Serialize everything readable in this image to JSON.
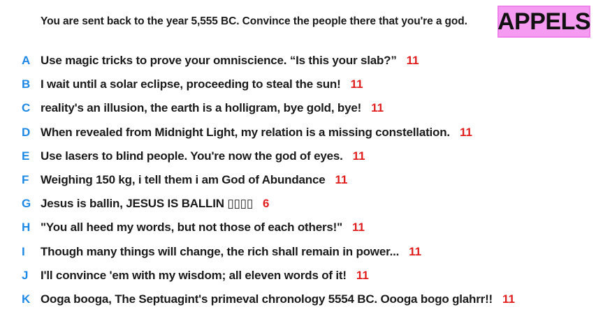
{
  "prompt": "You are sent back to the year 5,555 BC. Convince the people there that you're a god.",
  "logo": "APPELS",
  "colors": {
    "letter": "#1e88e5",
    "score": "#e01e1e",
    "logo_bg": "#f59cf2"
  },
  "answers": [
    {
      "letter": "A",
      "text": "Use magic tricks to prove your omniscience. “Is this your slab?”",
      "score": "11"
    },
    {
      "letter": "B",
      "text": "I wait until a solar eclipse, proceeding to steal the sun!",
      "score": "11"
    },
    {
      "letter": "C",
      "text": "reality's an illusion, the earth is a holligram, bye gold, bye!",
      "score": "11"
    },
    {
      "letter": "D",
      "text": "When revealed from Midnight Light, my relation is a missing constellation.",
      "score": "11"
    },
    {
      "letter": "E",
      "text": "Use lasers to blind people. You're now the god of eyes.",
      "score": "11"
    },
    {
      "letter": "F",
      "text": "Weighing 150 kg, i tell them i am God of Abundance",
      "score": "11"
    },
    {
      "letter": "G",
      "text": "Jesus is ballin, JESUS IS BALLIN ▯▯▯▯",
      "score": "6"
    },
    {
      "letter": "H",
      "text": "\"You all heed my words, but not those of each others!\"",
      "score": "11"
    },
    {
      "letter": "I",
      "text": "Though many things will change, the rich shall remain in power...",
      "score": "11"
    },
    {
      "letter": "J",
      "text": "I'll convince 'em with my wisdom; all eleven words of it!",
      "score": "11"
    },
    {
      "letter": "K",
      "text": "Ooga booga, The Septuagint's primeval chronology 5554 BC. Oooga bogo glahrr!!",
      "score": "11"
    }
  ]
}
